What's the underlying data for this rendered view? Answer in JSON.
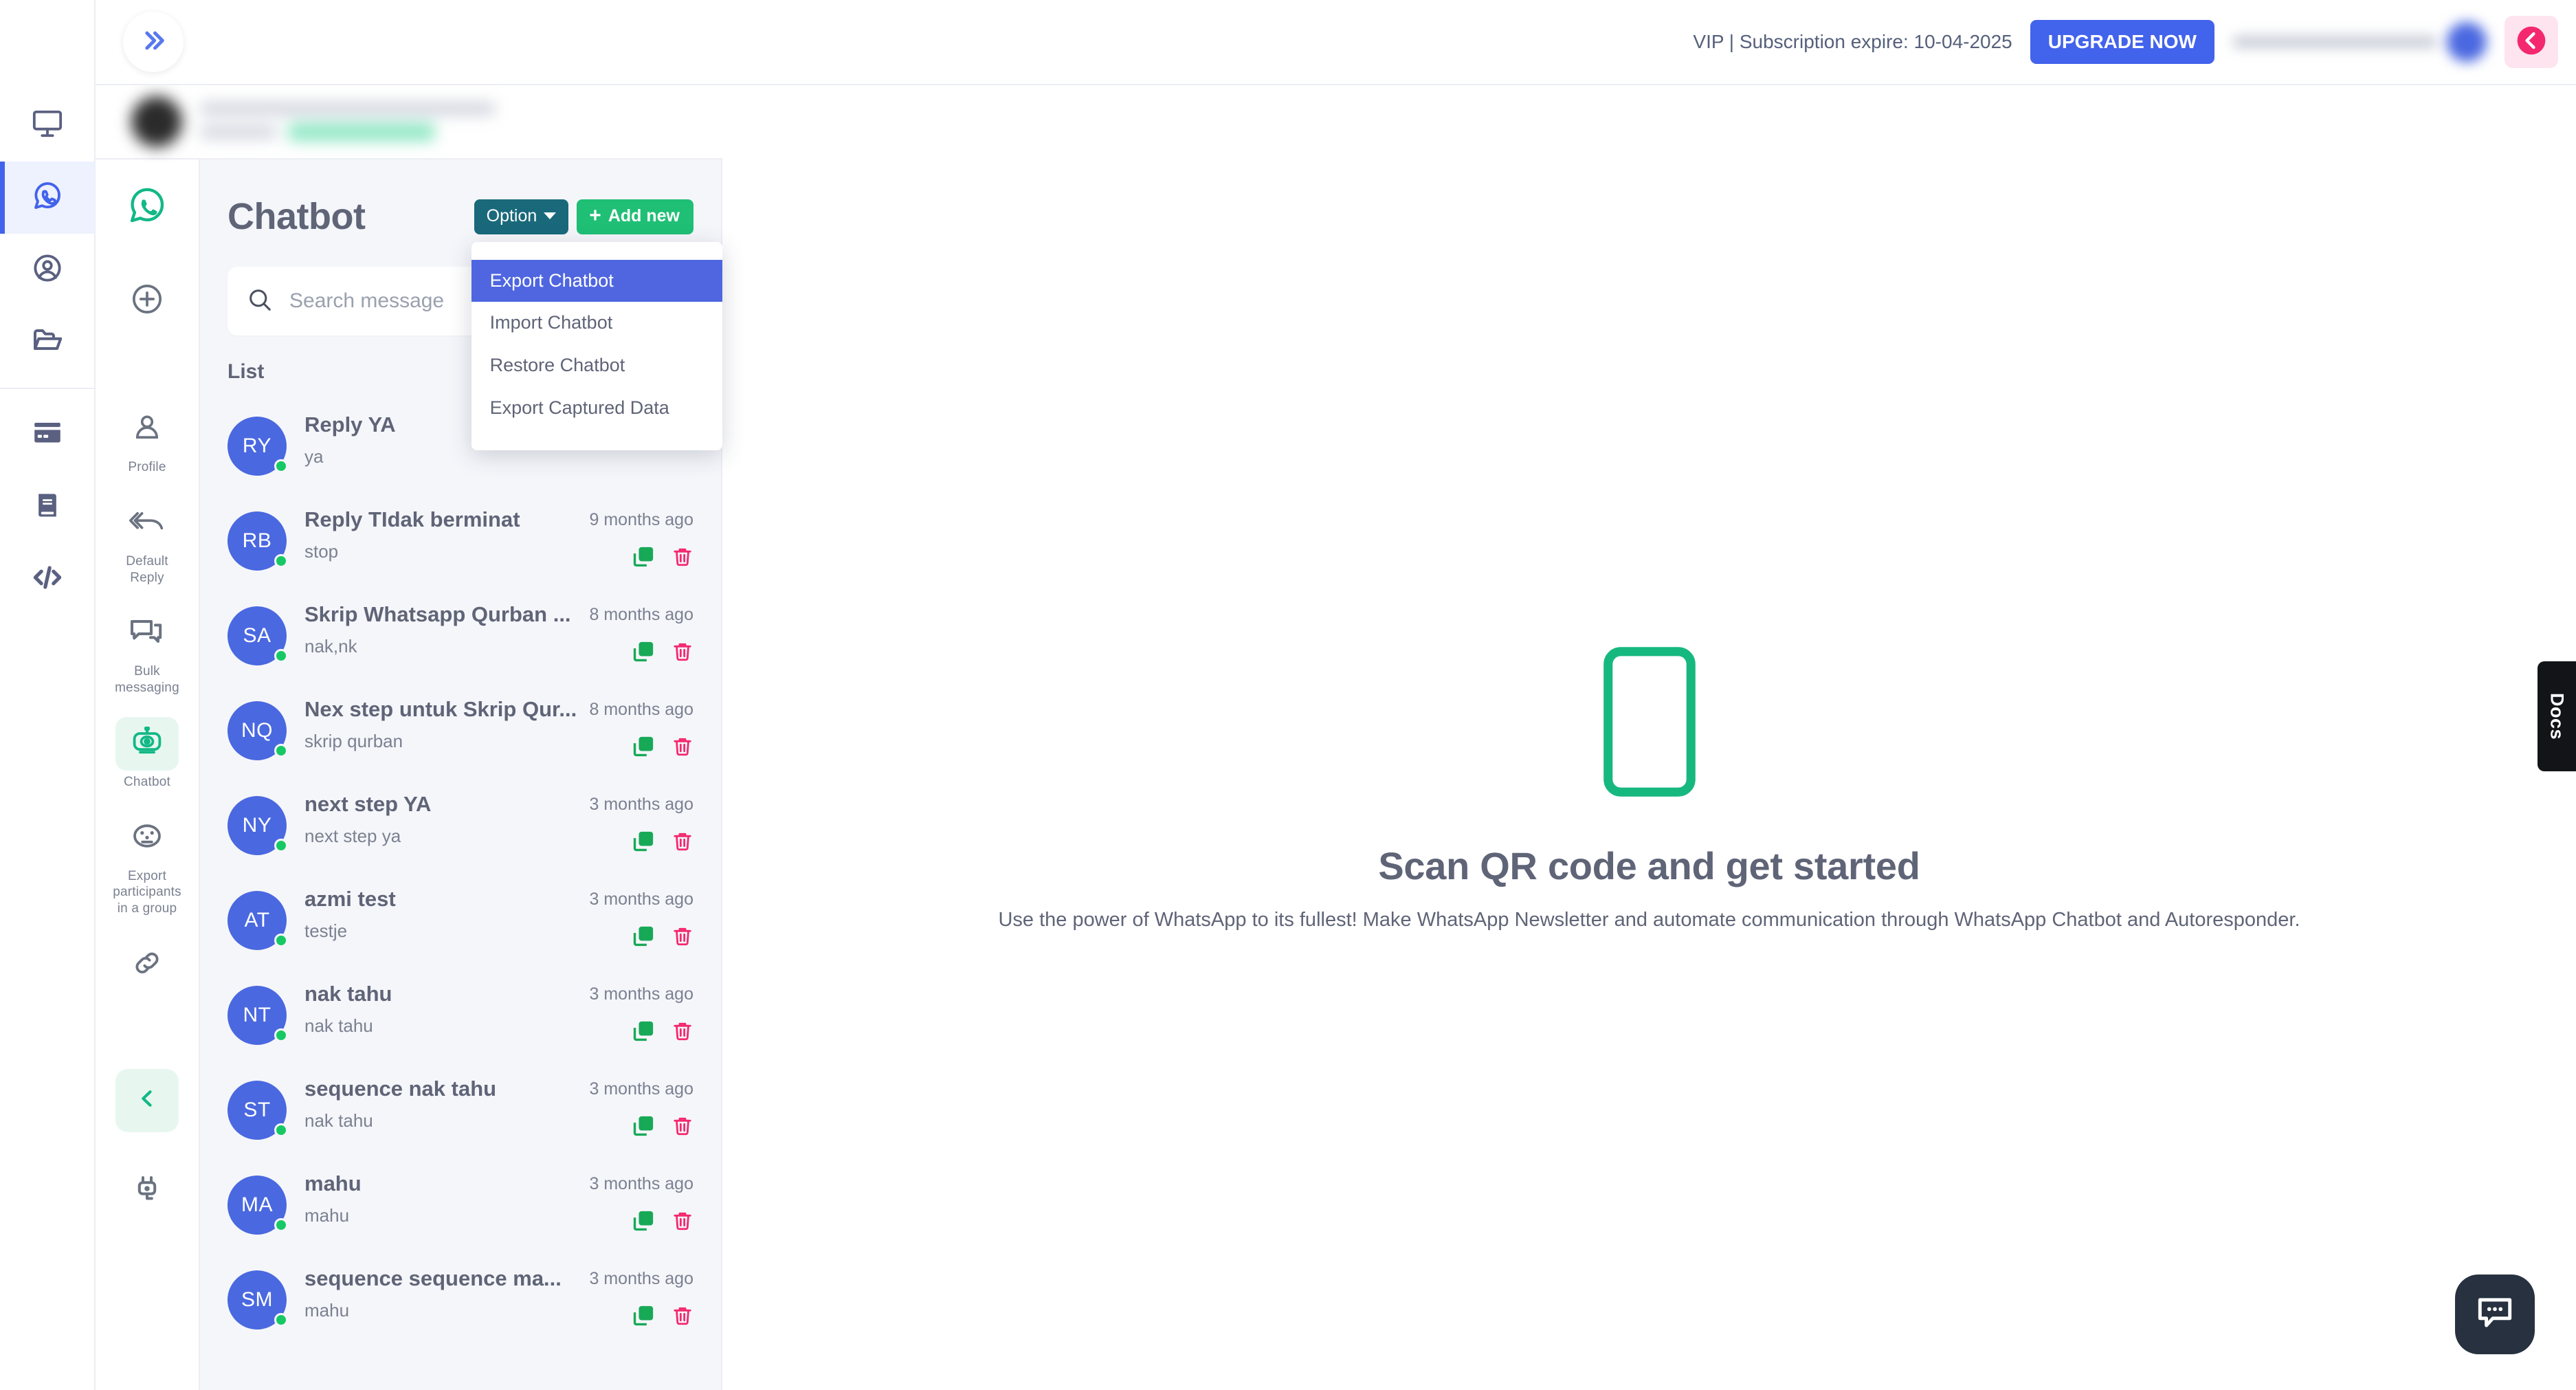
{
  "topbar": {
    "expand_icon": "chevrons-right-icon",
    "vip_text": "VIP | Subscription expire: 10-04-2025",
    "upgrade_label": "UPGRADE NOW",
    "close_icon": "chevron-left-circle-icon"
  },
  "rail": {
    "items": [
      {
        "name": "monitor-icon",
        "icon": "monitor"
      },
      {
        "name": "whatsapp-icon",
        "icon": "whatsapp",
        "active": true
      },
      {
        "name": "contact-icon",
        "icon": "user-circle"
      },
      {
        "name": "folder-icon",
        "icon": "folder"
      },
      {
        "name": "billing-icon",
        "icon": "credit-card"
      },
      {
        "name": "docs-book-icon",
        "icon": "book"
      },
      {
        "name": "developer-icon",
        "icon": "code"
      }
    ]
  },
  "side2": {
    "brand_icon": "whatsapp-icon",
    "add_icon": "plus-circle-icon",
    "items": [
      {
        "label": "Profile",
        "icon": "user-icon"
      },
      {
        "label": "Default Reply",
        "icon": "reply-all-icon"
      },
      {
        "label": "Bulk messaging",
        "icon": "chat-bubbles-icon"
      },
      {
        "label": "Chatbot",
        "icon": "robot-icon",
        "active": true
      },
      {
        "label": "Export participants in a group",
        "icon": "group-emoji-icon"
      },
      {
        "label": "",
        "icon": "link-icon"
      }
    ],
    "collapse_icon": "chevron-left-icon",
    "plug_icon": "plug-icon"
  },
  "list_panel": {
    "title": "Chatbot",
    "option_label": "Option",
    "add_new_label": "Add new",
    "dropdown": {
      "items": [
        {
          "label": "Export Chatbot",
          "highlighted": true
        },
        {
          "label": "Import Chatbot",
          "highlighted": false
        },
        {
          "label": "Restore Chatbot",
          "highlighted": false
        },
        {
          "label": "Export Captured Data",
          "highlighted": false
        }
      ]
    },
    "search": {
      "placeholder": "Search message",
      "value": "",
      "icon": "search-icon"
    },
    "list_label": "List",
    "rows": [
      {
        "initials": "RY",
        "title": "Reply YA",
        "subtitle": "ya",
        "time": ""
      },
      {
        "initials": "RB",
        "title": "Reply TIdak berminat",
        "subtitle": "stop",
        "time": "9 months ago"
      },
      {
        "initials": "SA",
        "title": "Skrip Whatsapp Qurban ...",
        "subtitle": "nak,nk",
        "time": "8 months ago"
      },
      {
        "initials": "NQ",
        "title": "Nex step untuk Skrip Qur...",
        "subtitle": "skrip qurban",
        "time": "8 months ago"
      },
      {
        "initials": "NY",
        "title": "next step YA",
        "subtitle": "next step ya",
        "time": "3 months ago"
      },
      {
        "initials": "AT",
        "title": "azmi test",
        "subtitle": "testje",
        "time": "3 months ago"
      },
      {
        "initials": "NT",
        "title": "nak tahu",
        "subtitle": "nak tahu",
        "time": "3 months ago"
      },
      {
        "initials": "ST",
        "title": "sequence nak tahu",
        "subtitle": "nak tahu",
        "time": "3 months ago"
      },
      {
        "initials": "MA",
        "title": "mahu",
        "subtitle": "mahu",
        "time": "3 months ago"
      },
      {
        "initials": "SM",
        "title": "sequence sequence ma...",
        "subtitle": "mahu",
        "time": "3 months ago"
      }
    ],
    "row_action_icons": {
      "copy": "copy-icon",
      "delete": "trash-icon"
    }
  },
  "main": {
    "phone_icon": "mobile-phone-icon",
    "heading": "Scan QR code and get started",
    "description": "Use the power of WhatsApp to its fullest! Make WhatsApp Newsletter and automate communication through WhatsApp Chatbot and Autoresponder."
  },
  "docs_tab": {
    "label": "Docs"
  },
  "fab": {
    "icon": "chat-dots-icon"
  },
  "colors": {
    "accent_blue": "#4263eb",
    "green": "#1fbf75",
    "teal": "#19697b",
    "menu_highlight": "#4f66e0",
    "pink": "#f4286e",
    "avatar_blue": "#4a68e0",
    "text_slate": "#5f6477",
    "panel_bg": "#f5f6fa"
  }
}
